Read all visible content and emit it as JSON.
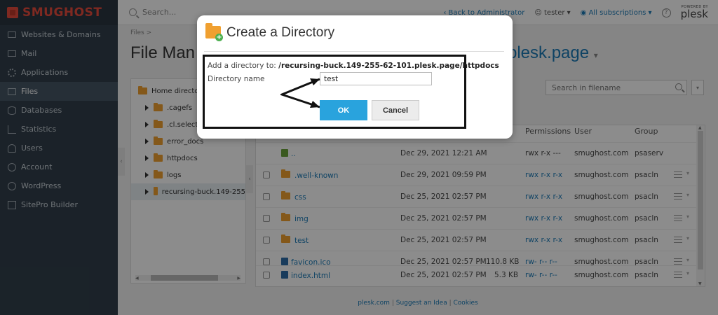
{
  "app": {
    "logo_text": "SMUGHOST"
  },
  "sidebar": {
    "items": [
      {
        "label": "Websites & Domains",
        "icon": "monitor-icon"
      },
      {
        "label": "Mail",
        "icon": "mail-icon"
      },
      {
        "label": "Applications",
        "icon": "gear-icon"
      },
      {
        "label": "Files",
        "icon": "folder-icon",
        "active": true
      },
      {
        "label": "Databases",
        "icon": "database-icon"
      },
      {
        "label": "Statistics",
        "icon": "chart-icon"
      },
      {
        "label": "Users",
        "icon": "user-icon"
      },
      {
        "label": "Account",
        "icon": "account-icon"
      },
      {
        "label": "WordPress",
        "icon": "wordpress-icon"
      },
      {
        "label": "SitePro Builder",
        "icon": "sitepro-icon"
      }
    ]
  },
  "topbar": {
    "search_placeholder": "Search...",
    "back_link": "Back to Administrator",
    "user": "tester",
    "subscriptions": "All subscriptions",
    "help": "?",
    "powered_by": "POWERED BY",
    "plesk": "plesk"
  },
  "main": {
    "breadcrumb": "Files >",
    "title_left": "File Man",
    "title_right": "plesk.page",
    "search_filename_placeholder": "Search in filename"
  },
  "tree": {
    "items": [
      {
        "label": "Home directo"
      },
      {
        "label": ".cagefs"
      },
      {
        "label": ".cl.selecto"
      },
      {
        "label": "error_docs"
      },
      {
        "label": "httpdocs"
      },
      {
        "label": "logs"
      },
      {
        "label": "recursing-buck.149-255"
      }
    ]
  },
  "files": {
    "columns": {
      "permissions": "Permissions",
      "user": "User",
      "group": "Group"
    },
    "rows": [
      {
        "name": "..",
        "date": "Dec 29, 2021 12:21 AM",
        "size": "",
        "perm": "rwx r-x ---",
        "user": "smughost.com",
        "group": "psaserv"
      },
      {
        "name": ".well-known",
        "date": "Dec 29, 2021 09:59 PM",
        "size": "",
        "perm": "rwx r-x r-x",
        "user": "smughost.com",
        "group": "psacln"
      },
      {
        "name": "css",
        "date": "Dec 25, 2021 02:57 PM",
        "size": "",
        "perm": "rwx r-x r-x",
        "user": "smughost.com",
        "group": "psacln"
      },
      {
        "name": "img",
        "date": "Dec 25, 2021 02:57 PM",
        "size": "",
        "perm": "rwx r-x r-x",
        "user": "smughost.com",
        "group": "psacln"
      },
      {
        "name": "test",
        "date": "Dec 25, 2021 02:57 PM",
        "size": "",
        "perm": "rwx r-x r-x",
        "user": "smughost.com",
        "group": "psacln"
      },
      {
        "name": "favicon.ico",
        "date": "Dec 25, 2021 02:57 PM",
        "size": "110.8 KB",
        "perm": "rw- r-- r--",
        "user": "smughost.com",
        "group": "psacln"
      },
      {
        "name": "index.html",
        "date": "Dec 25, 2021 02:57 PM",
        "size": "5.3 KB",
        "perm": "rw- r-- r--",
        "user": "smughost.com",
        "group": "psacln"
      }
    ]
  },
  "footer": {
    "link1": "plesk.com",
    "link2": "Suggest an Idea",
    "link3": "Cookies",
    "sep": "|"
  },
  "dialog": {
    "title": "Create a Directory",
    "add_prefix": "Add a directory to:",
    "path": "/recursing-buck.149-255-62-101.plesk.page/httpdocs",
    "name_label": "Directory name",
    "name_value": "test",
    "ok_label": "OK",
    "cancel_label": "Cancel"
  },
  "colors": {
    "accent": "#1c7bb7",
    "ok_button": "#29a3dd",
    "sidebar_bg": "#323f4b"
  }
}
